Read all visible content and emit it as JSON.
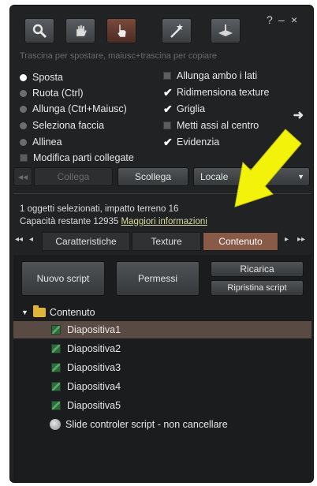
{
  "toolbar": {
    "tools": [
      {
        "icon": "magnifier-icon",
        "label": "focus"
      },
      {
        "icon": "hand-icon",
        "label": "move"
      },
      {
        "icon": "pointing-hand-icon",
        "label": "edit"
      },
      {
        "icon": "magic-wand-icon",
        "label": "create"
      },
      {
        "icon": "plane-icon",
        "label": "land"
      }
    ],
    "active_index": 2,
    "help_label": "?",
    "minimize_label": "–",
    "close_label": "×"
  },
  "hint": "Trascina per spostare, maiusc+trascina per copiare",
  "options_left": [
    {
      "label": "Sposta",
      "selected": true
    },
    {
      "label": "Ruota (Ctrl)",
      "selected": false
    },
    {
      "label": "Allunga (Ctrl+Maiusc)",
      "selected": false
    },
    {
      "label": "Seleziona faccia",
      "selected": false
    },
    {
      "label": "Allinea",
      "selected": false
    }
  ],
  "edit_linked": {
    "label": "Modifica parti collegate",
    "checked": false
  },
  "options_right": [
    {
      "label": "Allunga ambo i lati",
      "checked": false
    },
    {
      "label": "Ridimensiona texture",
      "checked": true
    },
    {
      "label": "Griglia",
      "checked": true
    },
    {
      "label": "Metti assi al centro",
      "checked": false
    },
    {
      "label": "Evidenzia",
      "checked": true
    }
  ],
  "link_row": {
    "link_label": "Collega",
    "unlink_label": "Scollega",
    "dropdown_value": "Locale"
  },
  "status": {
    "line1": "1 oggetti selezionati, impatto terreno 16",
    "line2_prefix": "Capacità restante 12935",
    "more_info_link": "Maggiori informazioni"
  },
  "tabs": [
    {
      "label": "Caratteristiche",
      "active": false
    },
    {
      "label": "Texture",
      "active": false
    },
    {
      "label": "Contenuto",
      "active": true
    }
  ],
  "content_buttons": {
    "new_script": "Nuovo script",
    "permissions": "Permessi",
    "refresh": "Ricarica",
    "reset_scripts": "Ripristina script"
  },
  "tree": {
    "root_label": "Contenuto",
    "items": [
      {
        "label": "Diapositiva1",
        "selected": true,
        "icon": "script-icon"
      },
      {
        "label": "Diapositiva2",
        "selected": false,
        "icon": "script-icon"
      },
      {
        "label": "Diapositiva3",
        "selected": false,
        "icon": "script-icon"
      },
      {
        "label": "Diapositiva4",
        "selected": false,
        "icon": "script-icon"
      },
      {
        "label": "Diapositiva5",
        "selected": false,
        "icon": "script-icon"
      },
      {
        "label": "Slide controler script - non cancellare",
        "selected": false,
        "icon": "object-icon"
      }
    ]
  },
  "colors": {
    "panel_bg": "#202224",
    "active_tab": "#8a5a48",
    "selected_row": "#5a4a44",
    "annotation_arrow": "#f2f20a"
  }
}
